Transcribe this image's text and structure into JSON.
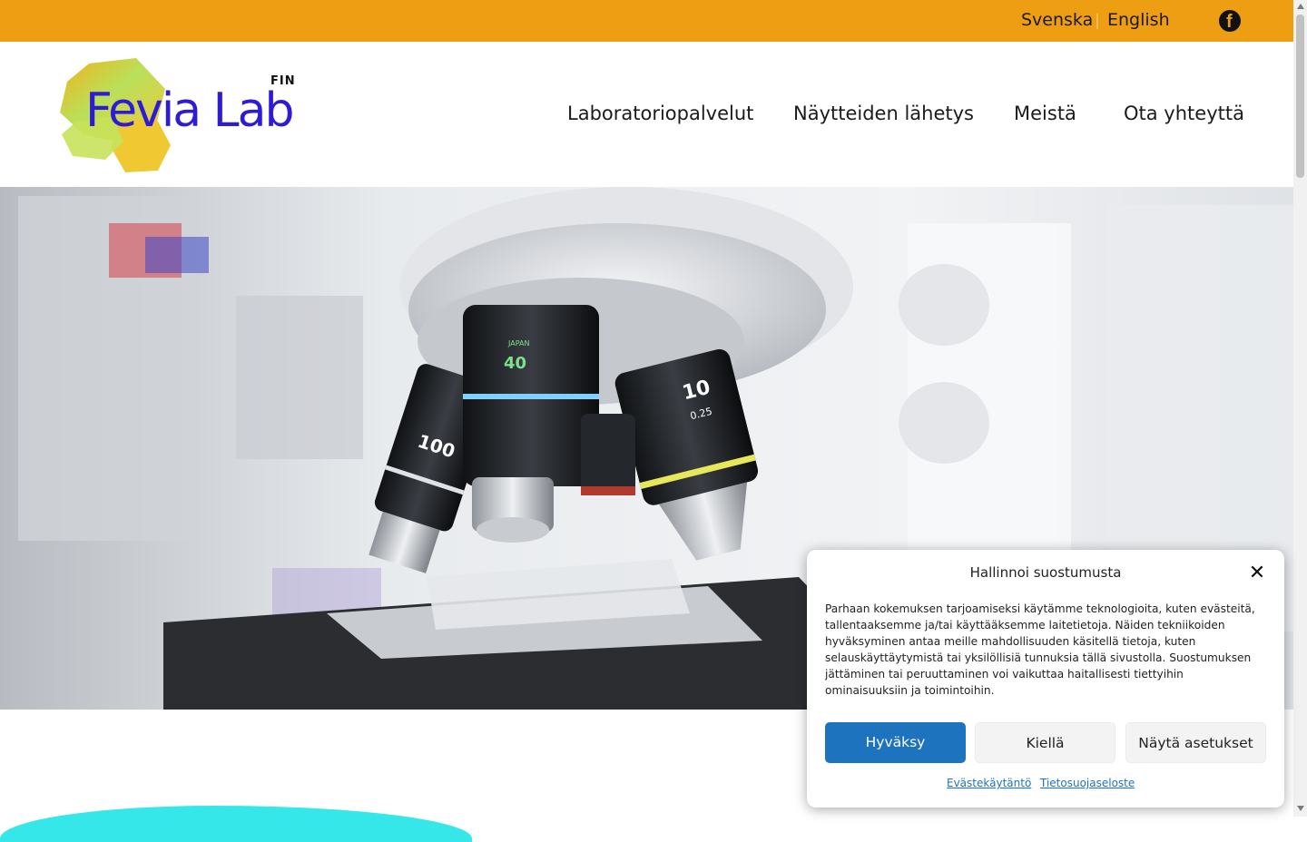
{
  "topbar": {
    "languages": [
      "Svenska",
      "English"
    ],
    "separator": "|",
    "social_icon": "facebook-icon",
    "bg_color": "#ee9e12"
  },
  "logo": {
    "brand": "Fevia Lab",
    "region": "FIN",
    "brand_color": "#2d1bd6"
  },
  "nav": {
    "items": [
      "Laboratoriopalvelut",
      "Näytteiden lähetys",
      "Meistä",
      "Ota yhteyttä"
    ]
  },
  "hero": {
    "image": "microscope-objectives-photo"
  },
  "cookie": {
    "title": "Hallinnoi suostumusta",
    "close_icon": "close-icon",
    "text": "Parhaan kokemuksen tarjoamiseksi käytämme teknologioita, kuten evästeitä, tallentaaksemme ja/tai käyttääksemme laitetietoja. Näiden tekniikoiden hyväksyminen antaa meille mahdollisuuden käsitellä tietoja, kuten selauskäyttäytymistä tai yksilöllisiä tunnuksia tällä sivustolla. Suostumuksen jättäminen tai peruuttaminen voi vaikuttaa haitallisesti tiettyihin ominaisuuksiin ja toimintoihin.",
    "accept": "Hyväksy",
    "deny": "Kiellä",
    "settings": "Näytä asetukset",
    "links": [
      "Evästekäytäntö",
      "Tietosuojaseloste"
    ],
    "accent_color": "#1e73be"
  }
}
